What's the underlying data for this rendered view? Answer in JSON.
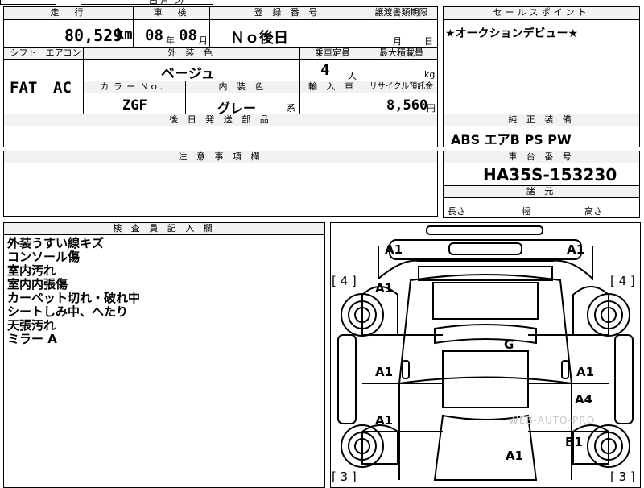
{
  "top_fragment": "昌 片 ラ/",
  "row1": {
    "mileage_label": "走　行",
    "mileage_value": "80,529",
    "mileage_unit": "km",
    "inspection_label": "車　検",
    "inspection_year": "08",
    "year_unit": "年",
    "inspection_month": "08",
    "month_unit": "月",
    "reg_label": "登 録 番 号",
    "reg_value": "Ｎｏ後日",
    "transfer_label": "譲渡書類期限",
    "transfer_month_unit": "月",
    "transfer_day_unit": "日"
  },
  "selling_points": {
    "label": "セールスポイント",
    "text": "★オークションデビュー★"
  },
  "row2": {
    "shift_label": "シフト",
    "ac_label": "エアコン",
    "exterior_label": "外 装 色",
    "capacity_label": "乗車定員",
    "max_load_label": "最大積載量",
    "shift_value": "FAT",
    "ac_value": "AC",
    "exterior_value": "ベ－ジュ",
    "capacity_value": "4",
    "capacity_unit": "人",
    "load_unit": "kg"
  },
  "row3": {
    "color_no_label": "カ ラ ー Ｎｏ．",
    "interior_label": "内 装 色",
    "import_label": "輸 入 車",
    "recycle_label": "リサイクル預託金",
    "color_no_value": "ZGF",
    "interior_value": "グレー",
    "interior_suffix": "系",
    "recycle_value": "8,560",
    "recycle_unit": "円"
  },
  "later_parts": {
    "label": "後 日 発 送 部 品"
  },
  "equipment": {
    "label": "純 正 装 備",
    "value": "ABS エアB PS PW"
  },
  "notes": {
    "label": "注 意 事 項 欄"
  },
  "chassis": {
    "label": "車 台 番 号",
    "value": "HA35S-153230"
  },
  "dimensions": {
    "label": "諸 元",
    "length": "長さ",
    "width": "幅",
    "height": "高さ"
  },
  "inspector": {
    "label": "検 査 員 記 入 欄",
    "remarks": [
      "外装うすい線キズ",
      "コンソール傷",
      "室内汚れ",
      "室内内張傷",
      "カーペット切れ・破れ中",
      "シートしみ中、へたり",
      "天張汚れ",
      "ミラー A"
    ]
  },
  "diagram": {
    "marks": [
      "A1",
      "A1",
      "A1",
      "G",
      "A1",
      "A1",
      "A4",
      "A1",
      "B1",
      "A1"
    ],
    "tire_labels": [
      "[ 4 ]",
      "[ 4 ]",
      "[ 3 ]",
      "[ 3 ]"
    ],
    "watermark": "WEB-AUTO-PRO"
  }
}
